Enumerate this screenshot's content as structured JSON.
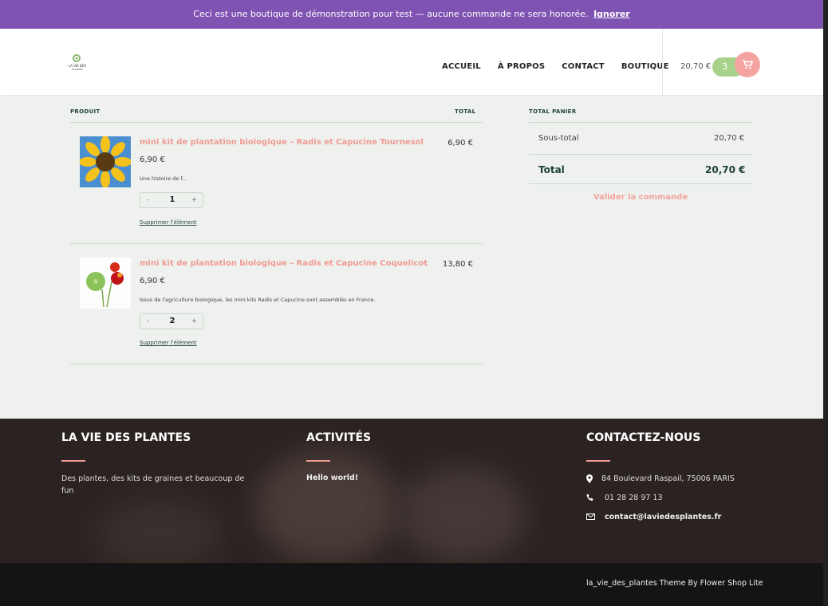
{
  "demo_notice": {
    "text": "Ceci est une boutique de démonstration pour test — aucune commande ne sera honorée.",
    "dismiss": "Ignorer"
  },
  "logo": {
    "line1": "LA VIE DES",
    "line2": "PLANTES"
  },
  "nav": [
    "ACCUEIL",
    "À PROPOS",
    "CONTACT",
    "BOUTIQUE"
  ],
  "cart": {
    "total": "20,70 €",
    "count": "3",
    "icon": "cart-icon"
  },
  "table_headers": {
    "product": "PRODUIT",
    "total": "TOTAL",
    "cart_totals": "TOTAL PANIER"
  },
  "items": [
    {
      "name": "mini kit de plantation biologique – Radis et Capucine Tournesol",
      "price": "6,90 €",
      "description": "Une histoire de f...",
      "quantity": "1",
      "total": "6,90 €",
      "remove": "Supprimer l'élément"
    },
    {
      "name": "mini kit de plantation biologique – Radis et Capucine Coquelicot",
      "price": "6,90 €",
      "description": "Issus de l'agriculture biologique, les mini kits Radis et Capucine sont assemblés en France.",
      "quantity": "2",
      "total": "13,80 €",
      "remove": "Supprimer l'élément"
    }
  ],
  "qty_controls": {
    "minus": "-",
    "plus": "+"
  },
  "totals": {
    "subtotal_label": "Sous-total",
    "subtotal": "20,70 €",
    "total_label": "Total",
    "total": "20,70 €",
    "checkout": "Valider la commande"
  },
  "footer": {
    "col1": {
      "title": "LA VIE DES PLANTES",
      "text": "Des plantes, des kits de graines et beaucoup de fun"
    },
    "col2": {
      "title": "ACTIVITÉS",
      "link": "Hello world!"
    },
    "col3": {
      "title": "CONTACTEZ-NOUS",
      "address": "84 Boulevard Raspail, 75006 PARIS",
      "phone": "01 28 28 97 13",
      "email": "contact@laviedesplantes.fr"
    },
    "credit": "la_vie_des_plantes Theme By Flower Shop Lite"
  },
  "colors": {
    "accent": "#f19a94",
    "purple": "#7f53b2",
    "green": "#a8d28a"
  }
}
